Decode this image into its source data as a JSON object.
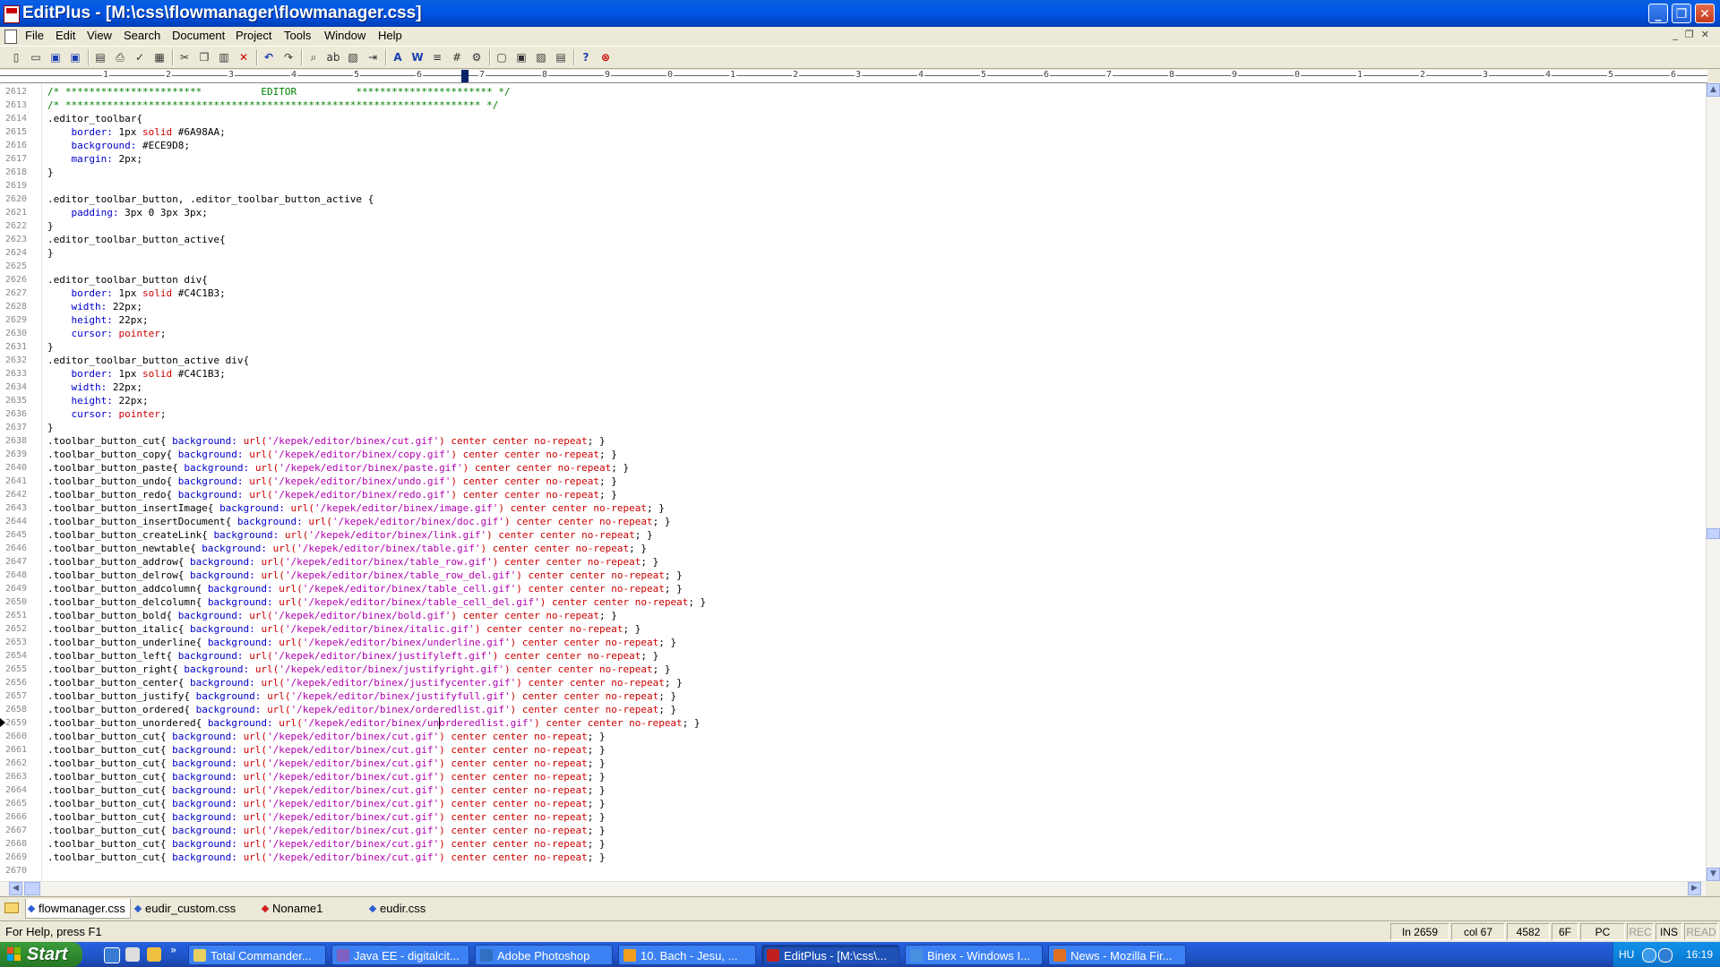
{
  "window": {
    "title": "EditPlus - [M:\\css\\flowmanager\\flowmanager.css]"
  },
  "menu": [
    "File",
    "Edit",
    "View",
    "Search",
    "Document",
    "Project",
    "Tools",
    "Window",
    "Help"
  ],
  "ruler": [
    "1",
    "2",
    "3",
    "4",
    "5",
    "6",
    "7",
    "8",
    "9",
    "0",
    "1",
    "2",
    "3",
    "4",
    "5",
    "6",
    "7",
    "8",
    "9",
    "0",
    "1",
    "2",
    "3",
    "4",
    "5",
    "6"
  ],
  "editor": {
    "current_line": 2659,
    "lines": [
      {
        "n": "2612",
        "code": "/* ***********************          EDITOR          *********************** */"
      },
      {
        "n": "2613",
        "code": "/* ********************************************************************** */"
      },
      {
        "n": "2614",
        "code": ".editor_toolbar{"
      },
      {
        "n": "2615",
        "code": "    border: 1px solid #6A98AA;"
      },
      {
        "n": "2616",
        "code": "    background: #ECE9D8;"
      },
      {
        "n": "2617",
        "code": "    margin: 2px;"
      },
      {
        "n": "2618",
        "code": "}"
      },
      {
        "n": "2619",
        "code": ""
      },
      {
        "n": "2620",
        "code": ".editor_toolbar_button, .editor_toolbar_button_active {"
      },
      {
        "n": "2621",
        "code": "    padding: 3px 0 3px 3px;"
      },
      {
        "n": "2622",
        "code": "}"
      },
      {
        "n": "2623",
        "code": ".editor_toolbar_button_active{"
      },
      {
        "n": "2624",
        "code": "}"
      },
      {
        "n": "2625",
        "code": ""
      },
      {
        "n": "2626",
        "code": ".editor_toolbar_button div{"
      },
      {
        "n": "2627",
        "code": "    border: 1px solid #C4C1B3;"
      },
      {
        "n": "2628",
        "code": "    width: 22px;"
      },
      {
        "n": "2629",
        "code": "    height: 22px;"
      },
      {
        "n": "2630",
        "code": "    cursor: pointer;"
      },
      {
        "n": "2631",
        "code": "}"
      },
      {
        "n": "2632",
        "code": ".editor_toolbar_button_active div{"
      },
      {
        "n": "2633",
        "code": "    border: 1px solid #C4C1B3;"
      },
      {
        "n": "2634",
        "code": "    width: 22px;"
      },
      {
        "n": "2635",
        "code": "    height: 22px;"
      },
      {
        "n": "2636",
        "code": "    cursor: pointer;"
      },
      {
        "n": "2637",
        "code": "}"
      },
      {
        "n": "2638",
        "code": ".toolbar_button_cut{ background: url('/kepek/editor/binex/cut.gif') center center no-repeat; }"
      },
      {
        "n": "2639",
        "code": ".toolbar_button_copy{ background: url('/kepek/editor/binex/copy.gif') center center no-repeat; }"
      },
      {
        "n": "2640",
        "code": ".toolbar_button_paste{ background: url('/kepek/editor/binex/paste.gif') center center no-repeat; }"
      },
      {
        "n": "2641",
        "code": ".toolbar_button_undo{ background: url('/kepek/editor/binex/undo.gif') center center no-repeat; }"
      },
      {
        "n": "2642",
        "code": ".toolbar_button_redo{ background: url('/kepek/editor/binex/redo.gif') center center no-repeat; }"
      },
      {
        "n": "2643",
        "code": ".toolbar_button_insertImage{ background: url('/kepek/editor/binex/image.gif') center center no-repeat; }"
      },
      {
        "n": "2644",
        "code": ".toolbar_button_insertDocument{ background: url('/kepek/editor/binex/doc.gif') center center no-repeat; }"
      },
      {
        "n": "2645",
        "code": ".toolbar_button_createLink{ background: url('/kepek/editor/binex/link.gif') center center no-repeat; }"
      },
      {
        "n": "2646",
        "code": ".toolbar_button_newtable{ background: url('/kepek/editor/binex/table.gif') center center no-repeat; }"
      },
      {
        "n": "2647",
        "code": ".toolbar_button_addrow{ background: url('/kepek/editor/binex/table_row.gif') center center no-repeat; }"
      },
      {
        "n": "2648",
        "code": ".toolbar_button_delrow{ background: url('/kepek/editor/binex/table_row_del.gif') center center no-repeat; }"
      },
      {
        "n": "2649",
        "code": ".toolbar_button_addcolumn{ background: url('/kepek/editor/binex/table_cell.gif') center center no-repeat; }"
      },
      {
        "n": "2650",
        "code": ".toolbar_button_delcolumn{ background: url('/kepek/editor/binex/table_cell_del.gif') center center no-repeat; }"
      },
      {
        "n": "2651",
        "code": ".toolbar_button_bold{ background: url('/kepek/editor/binex/bold.gif') center center no-repeat; }"
      },
      {
        "n": "2652",
        "code": ".toolbar_button_italic{ background: url('/kepek/editor/binex/italic.gif') center center no-repeat; }"
      },
      {
        "n": "2653",
        "code": ".toolbar_button_underline{ background: url('/kepek/editor/binex/underline.gif') center center no-repeat; }"
      },
      {
        "n": "2654",
        "code": ".toolbar_button_left{ background: url('/kepek/editor/binex/justifyleft.gif') center center no-repeat; }"
      },
      {
        "n": "2655",
        "code": ".toolbar_button_right{ background: url('/kepek/editor/binex/justifyright.gif') center center no-repeat; }"
      },
      {
        "n": "2656",
        "code": ".toolbar_button_center{ background: url('/kepek/editor/binex/justifycenter.gif') center center no-repeat; }"
      },
      {
        "n": "2657",
        "code": ".toolbar_button_justify{ background: url('/kepek/editor/binex/justifyfull.gif') center center no-repeat; }"
      },
      {
        "n": "2658",
        "code": ".toolbar_button_ordered{ background: url('/kepek/editor/binex/orderedlist.gif') center center no-repeat; }"
      },
      {
        "n": "2659",
        "code": ".toolbar_button_unordered{ background: url('/kepek/editor/binex/unorderedlist.gif') center center no-repeat; }"
      },
      {
        "n": "2660",
        "code": ".toolbar_button_cut{ background: url('/kepek/editor/binex/cut.gif') center center no-repeat; }"
      },
      {
        "n": "2661",
        "code": ".toolbar_button_cut{ background: url('/kepek/editor/binex/cut.gif') center center no-repeat; }"
      },
      {
        "n": "2662",
        "code": ".toolbar_button_cut{ background: url('/kepek/editor/binex/cut.gif') center center no-repeat; }"
      },
      {
        "n": "2663",
        "code": ".toolbar_button_cut{ background: url('/kepek/editor/binex/cut.gif') center center no-repeat; }"
      },
      {
        "n": "2664",
        "code": ".toolbar_button_cut{ background: url('/kepek/editor/binex/cut.gif') center center no-repeat; }"
      },
      {
        "n": "2665",
        "code": ".toolbar_button_cut{ background: url('/kepek/editor/binex/cut.gif') center center no-repeat; }"
      },
      {
        "n": "2666",
        "code": ".toolbar_button_cut{ background: url('/kepek/editor/binex/cut.gif') center center no-repeat; }"
      },
      {
        "n": "2667",
        "code": ".toolbar_button_cut{ background: url('/kepek/editor/binex/cut.gif') center center no-repeat; }"
      },
      {
        "n": "2668",
        "code": ".toolbar_button_cut{ background: url('/kepek/editor/binex/cut.gif') center center no-repeat; }"
      },
      {
        "n": "2669",
        "code": ".toolbar_button_cut{ background: url('/kepek/editor/binex/cut.gif') center center no-repeat; }"
      },
      {
        "n": "2670",
        "code": ""
      }
    ]
  },
  "tabs": [
    {
      "label": "flowmanager.css",
      "active": true,
      "modified": false
    },
    {
      "label": "eudir_custom.css",
      "active": false,
      "modified": false
    },
    {
      "label": "Noname1",
      "active": false,
      "modified": true
    },
    {
      "label": "eudir.css",
      "active": false,
      "modified": false
    }
  ],
  "status": {
    "help": "For Help, press F1",
    "line": "In 2659",
    "col": "col 67",
    "total": "4582",
    "hex": "6F",
    "format": "PC",
    "rec": "REC",
    "ins": "INS",
    "read": "READ"
  },
  "taskbar": {
    "start": "Start",
    "tasks": [
      {
        "label": "Total Commander...",
        "color": "#E8D060"
      },
      {
        "label": "Java EE - digitalcit...",
        "color": "#8060C0"
      },
      {
        "label": "Adobe Photoshop",
        "color": "#3070C0"
      },
      {
        "label": "10. Bach - Jesu, ...",
        "color": "#F0A020"
      },
      {
        "label": "EditPlus - [M:\\css\\...",
        "color": "#C02020"
      },
      {
        "label": "Binex - Windows I...",
        "color": "#4A90E0"
      },
      {
        "label": "News - Mozilla Fir...",
        "color": "#E07020"
      }
    ],
    "active_task": 4,
    "lang": "HU",
    "clock": "16:19"
  },
  "colors": {
    "titlebar": "#0058E6",
    "taskbar": "#245EDC",
    "start": "#2F8B2F"
  }
}
